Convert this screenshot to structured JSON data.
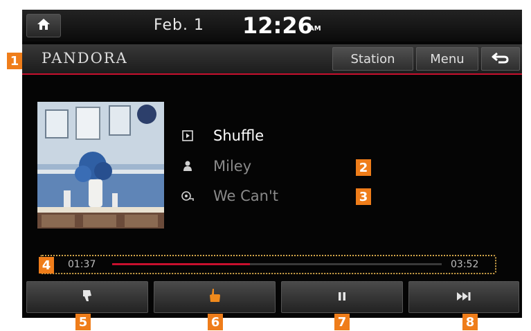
{
  "status_bar": {
    "date": "Feb. 1",
    "time": "12:26",
    "ampm": "AM"
  },
  "header": {
    "brand": "PANDORA",
    "station_label": "Station",
    "menu_label": "Menu"
  },
  "track": {
    "station": "Shuffle",
    "artist": "Miley",
    "title": "We Can't"
  },
  "progress": {
    "elapsed": "01:37",
    "total": "03:52",
    "fraction": 0.418
  },
  "controls": [
    {
      "icon": "thumbs-down-icon"
    },
    {
      "icon": "thumbs-up-icon"
    },
    {
      "icon": "pause-icon"
    },
    {
      "icon": "skip-next-icon"
    }
  ],
  "callouts": [
    "1",
    "2",
    "3",
    "4",
    "5",
    "6",
    "7",
    "8"
  ],
  "colors": {
    "accent": "#c8102e",
    "callout": "#ef7d1a",
    "thumbs_up": "#f08a1c"
  }
}
